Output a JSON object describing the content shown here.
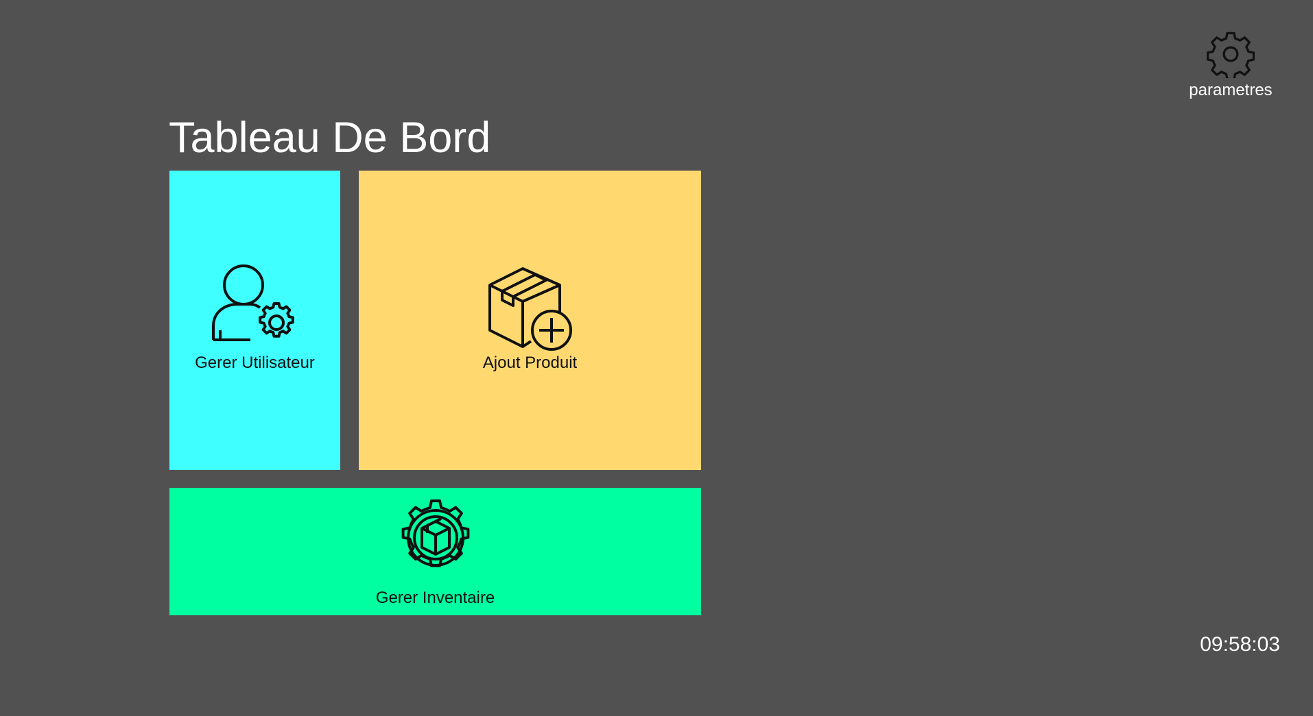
{
  "header": {
    "title": "Tableau De Bord",
    "settings": {
      "icon": "gear-icon",
      "label": "parametres"
    }
  },
  "tiles": [
    {
      "id": "users",
      "label": "Gerer Utilisateur",
      "icon": "user-settings-icon",
      "color": "#40FFFF"
    },
    {
      "id": "product",
      "label": "Ajout Produit",
      "icon": "box-add-icon",
      "color": "#FFD970"
    },
    {
      "id": "inventory",
      "label": "Gerer Inventaire",
      "icon": "inventory-gear-box-icon",
      "color": "#00FFA0"
    }
  ],
  "clock": {
    "time": "09:58:03"
  },
  "colors": {
    "background": "#515151",
    "text_light": "#FFFFFF",
    "icon_stroke": "#111111"
  }
}
